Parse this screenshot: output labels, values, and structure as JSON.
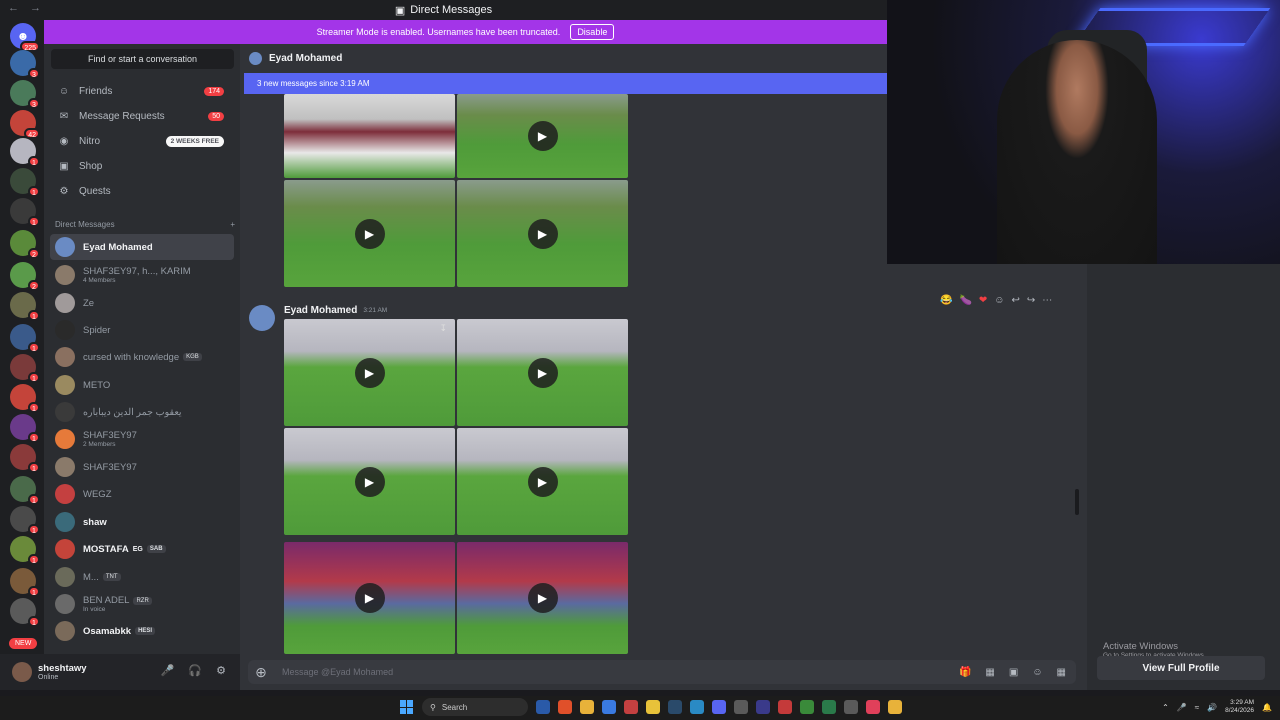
{
  "window": {
    "title": "Direct Messages",
    "nav": "← →"
  },
  "banner": {
    "text": "Streamer Mode is enabled. Usernames have been truncated.",
    "button": "Disable"
  },
  "rail": {
    "home_badge": "225",
    "servers": [
      {
        "badge": "3",
        "color": "#3a6aa8"
      },
      {
        "badge": "3",
        "color": "#4a7a5a"
      },
      {
        "badge": "42",
        "color": "#c4443a"
      },
      {
        "badge": "1",
        "color": "#b6b6c0"
      },
      {
        "badge": "1",
        "color": "#3a4a3a"
      },
      {
        "badge": "1",
        "color": "#3a3a3a"
      },
      {
        "badge": "2",
        "color": "#5a8a3a"
      },
      {
        "badge": "2",
        "color": "#5a9a4a"
      },
      {
        "badge": "1",
        "color": "#6a6a4a"
      },
      {
        "badge": "1",
        "color": "#3a5a8a"
      },
      {
        "badge": "1",
        "color": "#7a3a3a"
      },
      {
        "badge": "1",
        "color": "#c4443a"
      },
      {
        "badge": "1",
        "color": "#6a3a8a"
      },
      {
        "badge": "1",
        "color": "#8a3a3a"
      },
      {
        "badge": "1",
        "color": "#4a6a4a"
      },
      {
        "badge": "1",
        "color": "#4a4a4a"
      },
      {
        "badge": "1",
        "color": "#6a8a3a"
      },
      {
        "badge": "1",
        "color": "#7a5a3a"
      },
      {
        "badge": "1",
        "color": "#5a5a5a"
      }
    ],
    "new_label": "NEW"
  },
  "sidebar": {
    "search_label": "Find or start a conversation",
    "nav": [
      {
        "label": "Friends",
        "icon": "friends-icon",
        "count": "174"
      },
      {
        "label": "Message Requests",
        "icon": "mail-icon",
        "count": "50"
      },
      {
        "label": "Nitro",
        "icon": "nitro-icon",
        "pill": "2 WEEKS FREE"
      },
      {
        "label": "Shop",
        "icon": "shop-icon"
      },
      {
        "label": "Quests",
        "icon": "quests-icon"
      }
    ],
    "dm_header": "Direct Messages",
    "dm_add": "+",
    "dms": [
      {
        "name": "Eyad Mohamed",
        "color": "#6a8bc4",
        "active": true
      },
      {
        "name": "SHAF3EY97, h..., KARIM",
        "sub": "4 Members",
        "color": "#8a7a6a"
      },
      {
        "name": "Ze",
        "color": "#a09a9a"
      },
      {
        "name": "Spider",
        "color": "#2a2a2a"
      },
      {
        "name": "cursed with knowledge",
        "tag": "KGB",
        "color": "#8a7060"
      },
      {
        "name": "METO",
        "color": "#9a8a60"
      },
      {
        "name": "يعقوب جمر الدين ديباباره",
        "color": "#3a3a3a"
      },
      {
        "name": "SHAF3EY97",
        "sub": "2 Members",
        "color": "#e67a3a"
      },
      {
        "name": "SHAF3EY97",
        "color": "#8a7a6a"
      },
      {
        "name": "WEGZ",
        "color": "#c44040"
      },
      {
        "name": "shaw",
        "color": "#3a6a7a",
        "bold": true
      },
      {
        "name": "MOSTAFA",
        "tag": "SAB",
        "region": "EG",
        "color": "#c4443a",
        "bold": true
      },
      {
        "name": "M...",
        "tag": "TNT",
        "color": "#6a6a5a"
      },
      {
        "name": "BEN ADEL",
        "tag": "RZR",
        "sub": "In voice",
        "color": "#6a6a6a"
      },
      {
        "name": "Osamabkk",
        "tag": "HESI",
        "color": "#7a6a5a",
        "bold": true
      }
    ]
  },
  "user": {
    "name": "sheshtawy",
    "status": "Online"
  },
  "chat": {
    "recipient": "Eyad Mohamed",
    "new_messages": "3 new messages since 3:19 AM",
    "message_author": "Eyad Mohamed",
    "message_time": "3:21 AM",
    "composer_placeholder": "Message @Eyad Mohamed"
  },
  "right_panel": {
    "activate_title": "Activate Windows",
    "activate_sub": "Go to Settings to activate Windows.",
    "view_profile": "View Full Profile"
  },
  "taskbar": {
    "search": "Search",
    "time": "3:29 AM",
    "date": "8/24/2026"
  }
}
